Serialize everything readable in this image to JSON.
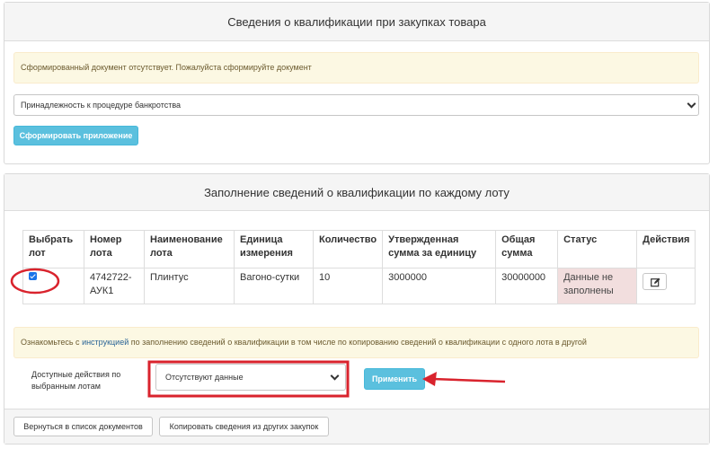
{
  "panel1": {
    "title": "Сведения о квалификации при закупках товара",
    "alert": "Сформированный документ отсутствует. Пожалуйста сформируйте документ",
    "select_value": "Принадлежность к процедуре банкротства",
    "generate_button": "Сформировать приложение"
  },
  "panel2": {
    "title": "Заполнение сведений о квалификации по каждому лоту",
    "table": {
      "headers": [
        "Выбрать лот",
        "Номер лота",
        "Наименование лота",
        "Единица измерения",
        "Количество",
        "Утвержденная сумма за единицу",
        "Общая сумма",
        "Статус",
        "Действия"
      ],
      "rows": [
        {
          "selected": true,
          "lot_number": "4742722-АУК1",
          "lot_name": "Плинтус",
          "unit": "Вагоно-сутки",
          "quantity": "10",
          "unit_price": "3000000",
          "total": "30000000",
          "status": "Данные не заполнены"
        }
      ]
    },
    "info": {
      "prefix": "Ознакомьтесь с",
      "link": "инструкцией",
      "suffix": "по заполнению сведений о квалификации в том числе по копированию сведений о квалификации с одного лота в другой"
    },
    "actions_label": "Доступные действия по выбранным лотам",
    "actions_select_value": "Отсутствуют данные",
    "apply_button": "Применить"
  },
  "footer": {
    "back_button": "Вернуться в список документов",
    "copy_button": "Копировать сведения из других закупок"
  },
  "colors": {
    "info_button": "#5bc0de",
    "alert_bg": "#fcf8e3",
    "status_bg": "#f2dede",
    "annotation_red": "#d9232d",
    "checkbox_blue": "#1a73e8"
  },
  "icons": [
    "chevron-down-icon",
    "edit-icon",
    "checkbox-checked-icon"
  ]
}
